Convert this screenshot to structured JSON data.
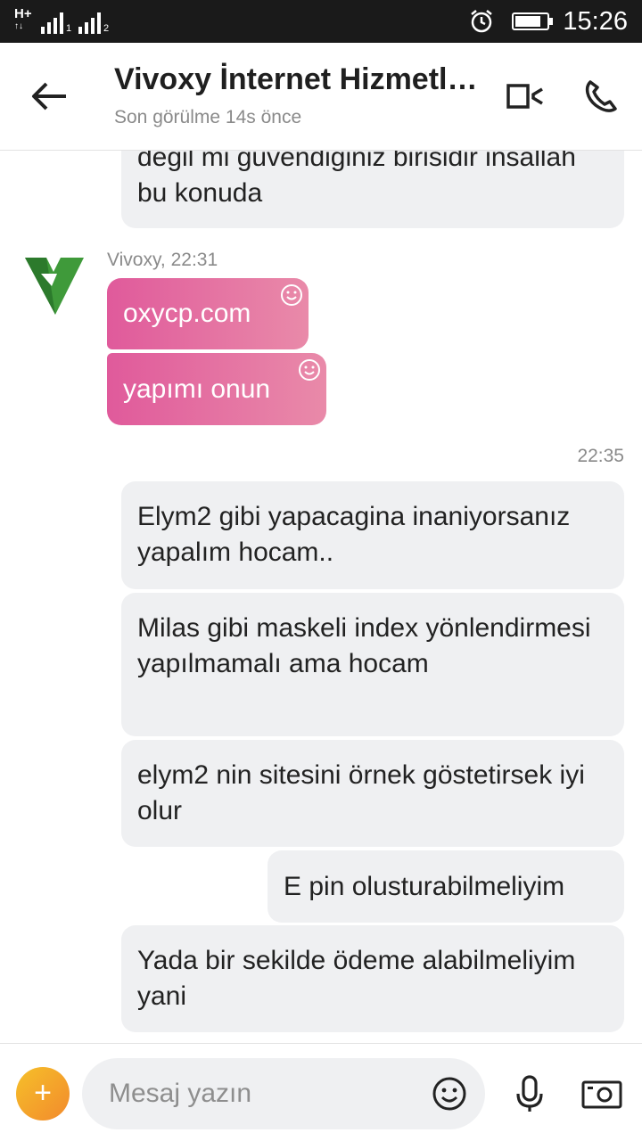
{
  "status_bar": {
    "network_1": "H+",
    "network_sim": "1",
    "network_sim2": "2",
    "time": "15:26"
  },
  "header": {
    "title": "Vivoxy İnternet Hizmetleri",
    "subtitle": "Son görülme 14s önce"
  },
  "messages": {
    "partial_out": "degil mi guvendiginiz birisidir insallah bu konuda",
    "sender_meta": "Vivoxy, 22:31",
    "in": [
      {
        "text": "oxycp.com"
      },
      {
        "text": "yapımı onun"
      }
    ],
    "time_label": "22:35",
    "out": [
      {
        "text": "Elym2 gibi yapacagina inaniyorsanız yapalım hocam.."
      },
      {
        "text": "Milas gibi maskeli index yönlendirmesi yapılmamalı ama hocam"
      },
      {
        "text": "elym2 nin sitesini örnek göstetirsek iyi olur"
      },
      {
        "text": "E pin olusturabilmeliyim"
      },
      {
        "text": "Yada bir sekilde ödeme alabilmeliyim yani"
      }
    ]
  },
  "composer": {
    "placeholder": "Mesaj yazın",
    "add_label": "+"
  },
  "colors": {
    "accent_pink": "#e05a9b",
    "bubble_gray": "#eff0f2",
    "add_orange": "#f28a2c"
  }
}
